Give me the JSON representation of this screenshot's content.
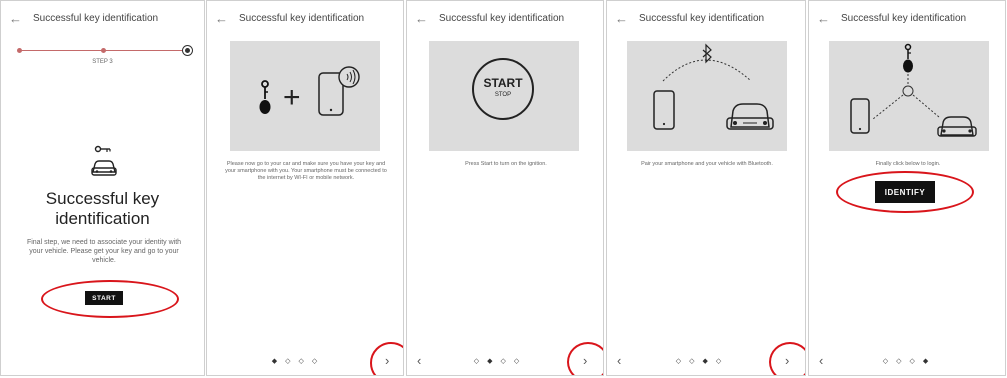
{
  "header": {
    "title": "Successful key identification",
    "back_icon": "arrow-left-icon"
  },
  "panels": [
    {
      "step_label": "STEP 3",
      "title": "Successful key identification",
      "description": "Final step, we need to associate your identity with your vehicle. Please get your key and go to your vehicle.",
      "button_label": "START"
    },
    {
      "description": "Please now go to your car and make sure you have your key and your smartphone with you. Your smartphone must be connected to the internet by WI-FI or mobile network.",
      "dots": [
        "◆",
        "◇",
        "◇",
        "◇"
      ],
      "next": "›"
    },
    {
      "start_label": "START",
      "stop_label": "STOP",
      "description": "Press Start to turn on the ignition.",
      "dots": [
        "◇",
        "◆",
        "◇",
        "◇"
      ],
      "prev": "‹",
      "next": "›"
    },
    {
      "description": "Pair your smartphone and your vehicle with Bluetooth.",
      "dots": [
        "◇",
        "◇",
        "◆",
        "◇"
      ],
      "prev": "‹",
      "next": "›"
    },
    {
      "description": "Finally click below to login.",
      "button_label": "IDENTIFY",
      "dots": [
        "◇",
        "◇",
        "◇",
        "◆"
      ],
      "prev": "‹"
    }
  ],
  "colors": {
    "highlight": "#d9151b",
    "button": "#111111",
    "illustration_bg": "#dcdcdc"
  }
}
